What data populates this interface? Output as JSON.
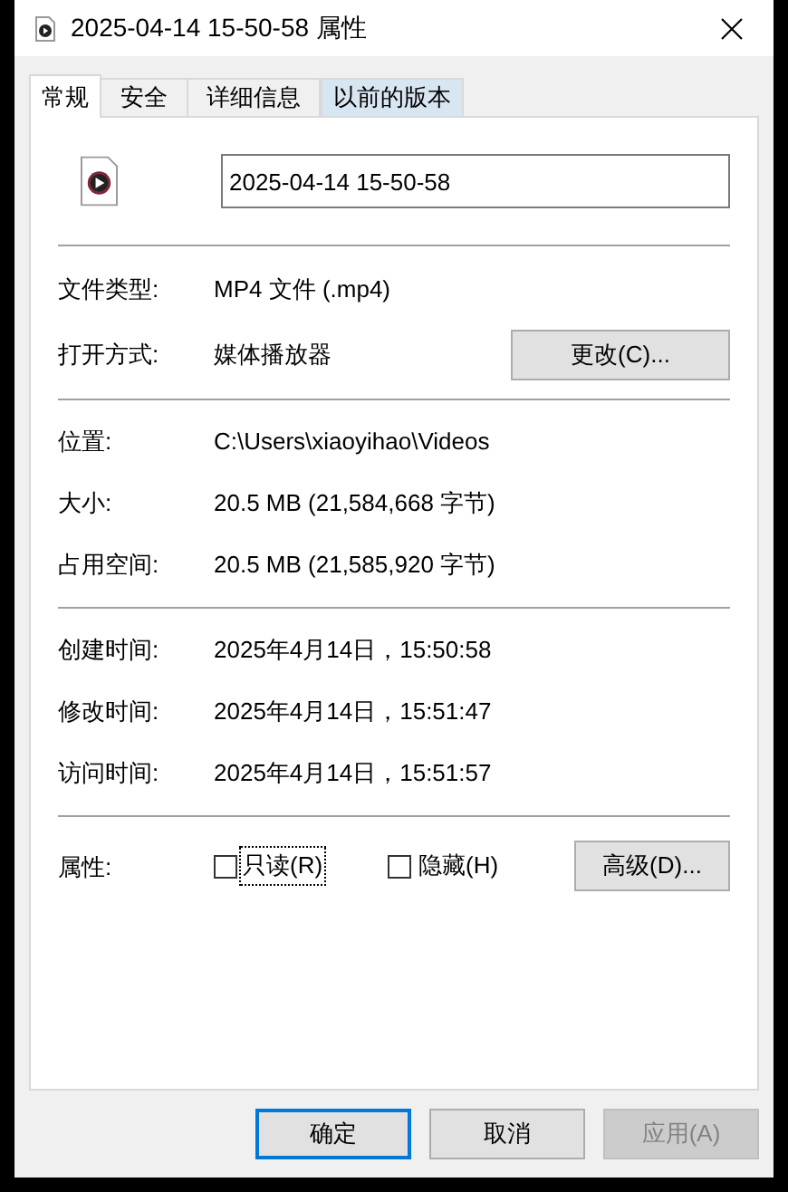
{
  "window": {
    "title": "2025-04-14 15-50-58 属性"
  },
  "tabs": [
    {
      "label": "常规",
      "selected": true,
      "hovered": false
    },
    {
      "label": "安全",
      "selected": false,
      "hovered": false
    },
    {
      "label": "详细信息",
      "selected": false,
      "hovered": false
    },
    {
      "label": "以前的版本",
      "selected": false,
      "hovered": true
    }
  ],
  "file_name": {
    "value": "2025-04-14 15-50-58"
  },
  "sections": [
    [
      {
        "label": "文件类型:",
        "value": "MP4 文件 (.mp4)"
      },
      {
        "label": "打开方式:",
        "value": "媒体播放器",
        "button": "更改(C)..."
      }
    ],
    [
      {
        "label": "位置:",
        "value": "C:\\Users\\xiaoyihao\\Videos"
      },
      {
        "label": "大小:",
        "value": "20.5 MB (21,584,668 字节)"
      },
      {
        "label": "占用空间:",
        "value": "20.5 MB (21,585,920 字节)"
      }
    ],
    [
      {
        "label": "创建时间:",
        "value": "2025年4月14日，15:50:58"
      },
      {
        "label": "修改时间:",
        "value": "2025年4月14日，15:51:47"
      },
      {
        "label": "访问时间:",
        "value": "2025年4月14日，15:51:57"
      }
    ]
  ],
  "attributes": {
    "label": "属性:",
    "checkboxes": [
      {
        "label": "只读(R)",
        "checked": false,
        "focused": true
      },
      {
        "label": "隐藏(H)",
        "checked": false,
        "focused": false
      }
    ],
    "button": "高级(D)..."
  },
  "buttons": [
    {
      "label": "确定",
      "default": true,
      "disabled": false
    },
    {
      "label": "取消",
      "default": false,
      "disabled": false
    },
    {
      "label": "应用(A)",
      "default": false,
      "disabled": true
    }
  ]
}
